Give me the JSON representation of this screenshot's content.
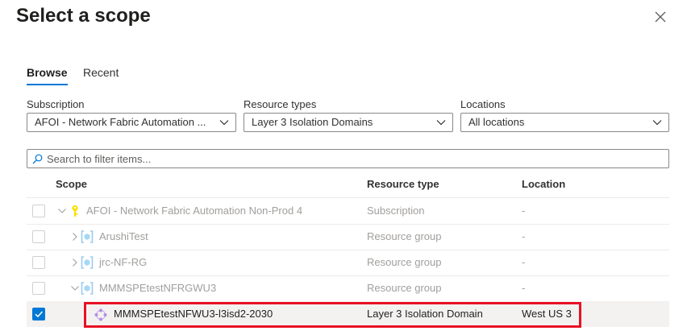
{
  "dialog": {
    "title": "Select a scope",
    "close_icon": "close-icon"
  },
  "tabs": [
    {
      "label": "Browse",
      "active": true
    },
    {
      "label": "Recent",
      "active": false
    }
  ],
  "filters": {
    "subscription": {
      "label": "Subscription",
      "value": "AFOI - Network Fabric Automation ..."
    },
    "resource_types": {
      "label": "Resource types",
      "value": "Layer 3 Isolation Domains"
    },
    "locations": {
      "label": "Locations",
      "value": "All locations"
    }
  },
  "search": {
    "placeholder": "Search to filter items..."
  },
  "table": {
    "headers": {
      "scope": "Scope",
      "resource_type": "Resource type",
      "location": "Location"
    },
    "rows": [
      {
        "scope": "AFOI - Network Fabric Automation Non-Prod 4",
        "type": "Subscription",
        "location": "-",
        "icon": "key-icon",
        "expander": "expanded",
        "checked": false
      },
      {
        "scope": "ArushiTest",
        "type": "Resource group",
        "location": "-",
        "icon": "resource-group-icon",
        "expander": "collapsed",
        "checked": false
      },
      {
        "scope": "jrc-NF-RG",
        "type": "Resource group",
        "location": "-",
        "icon": "resource-group-icon",
        "expander": "collapsed",
        "checked": false
      },
      {
        "scope": "MMMSPEtestNFRGWU3",
        "type": "Resource group",
        "location": "-",
        "icon": "resource-group-icon",
        "expander": "expanded",
        "checked": false
      },
      {
        "scope": "MMMSPEtestNFWU3-l3isd2-2030",
        "type": "Layer 3 Isolation Domain",
        "location": "West US 3",
        "icon": "isolation-domain-icon",
        "expander": "none",
        "checked": true
      }
    ]
  },
  "colors": {
    "accent": "#0078d4",
    "highlight_box": "#e81123",
    "disabled_text": "#a19f9d"
  }
}
